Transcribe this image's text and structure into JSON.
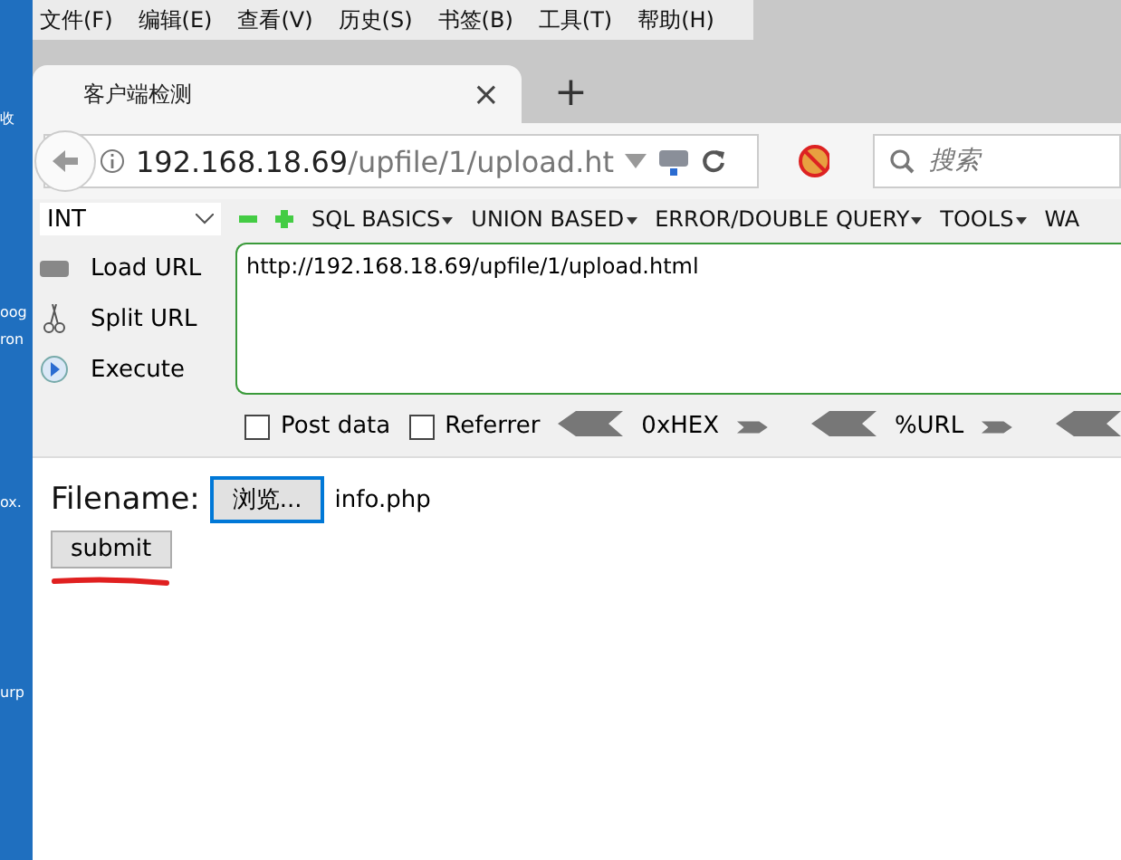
{
  "desktop_labels": [
    "收",
    "oog",
    "ron",
    "ox.",
    "urp"
  ],
  "menu_bar": [
    "文件(F)",
    "编辑(E)",
    "查看(V)",
    "历史(S)",
    "书签(B)",
    "工具(T)",
    "帮助(H)"
  ],
  "tab": {
    "title": "客户端检测",
    "close": "×",
    "new_tab": "+"
  },
  "address_bar": {
    "host": "192.168.18.69",
    "path": "/upfile/1/upload.ht"
  },
  "search": {
    "placeholder": "搜索"
  },
  "hackbar": {
    "select_value": "INT",
    "menus": [
      "SQL BASICS",
      "UNION BASED",
      "ERROR/DOUBLE QUERY",
      "TOOLS",
      "WA"
    ],
    "actions": [
      {
        "label": "Load URL",
        "kind": "load"
      },
      {
        "label": "Split URL",
        "kind": "split"
      },
      {
        "label": "Execute",
        "kind": "execute"
      }
    ],
    "url": "http://192.168.18.69/upfile/1/upload.html",
    "options": [
      {
        "label": "Post data",
        "checked": false
      },
      {
        "label": "Referrer",
        "checked": false
      }
    ],
    "encoders": [
      "0xHEX",
      "%URL"
    ]
  },
  "page": {
    "label": "Filename:",
    "browse_button": "浏览...",
    "file_name": "info.php",
    "submit_button": "submit"
  }
}
